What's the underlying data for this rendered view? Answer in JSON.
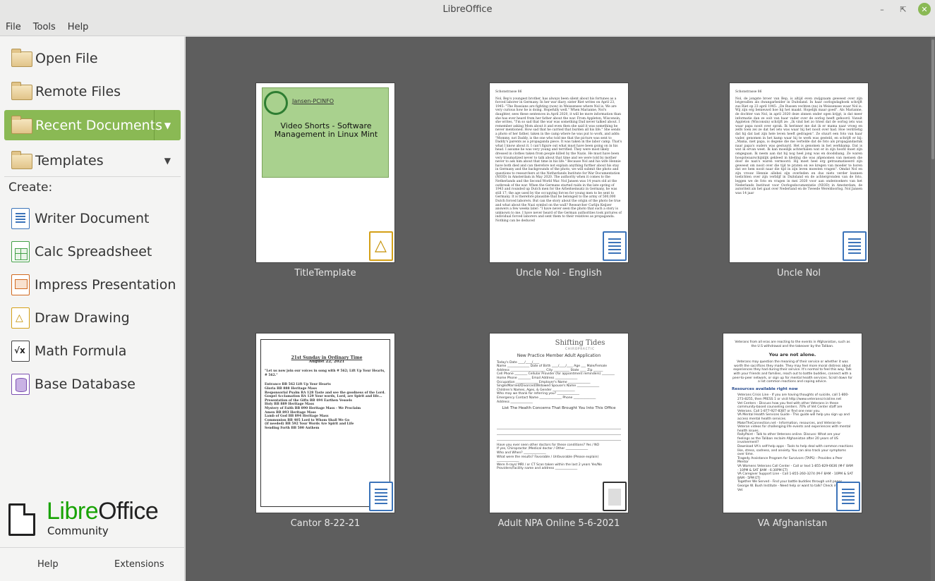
{
  "window": {
    "title": "LibreOffice"
  },
  "menu": [
    "File",
    "Tools",
    "Help"
  ],
  "sidebar": {
    "open_file": "Open File",
    "remote_files": "Remote Files",
    "recent_documents": "Recent Documents",
    "templates": "Templates",
    "create_label": "Create:",
    "create_items": [
      {
        "label": "Writer Document",
        "icon": "writer-icon"
      },
      {
        "label": "Calc Spreadsheet",
        "icon": "calc-icon"
      },
      {
        "label": "Impress Presentation",
        "icon": "impress-icon"
      },
      {
        "label": "Draw Drawing",
        "icon": "draw-icon"
      },
      {
        "label": "Math Formula",
        "icon": "math-icon"
      },
      {
        "label": "Base Database",
        "icon": "base-icon"
      }
    ],
    "logo": {
      "libre": "Libre",
      "office": "Office",
      "community": "Community"
    },
    "footer": {
      "help": "Help",
      "extensions": "Extensions"
    }
  },
  "accent_color": "#8ab954",
  "recent": [
    {
      "name": "TitleTemplate",
      "slide_brand": "Jansen-PCINFO",
      "slide_title": "Video Shorts - Software Management in Linux Mint"
    },
    {
      "name": "Uncle Nol - English",
      "heading": "Schonstrasse 86",
      "text": "Nol, Bep's youngest brother, has always been silent about his fortunes as a forced laborer in Germany. In her war diary, sister Riet writes on April 23, 1945: \"The Russians are fighting (now) in Weissensee where Nol is. We are very curious how he is doing. Hopefully well.\" When Marianne, Nol's daughter, sees these sentences in April 2020, it will be more information than she has ever heard from her father about the war. From Appleton, Wisconsin, she writes, \"I'm so sad that the war was something Dad never talked about. I remember asking Mom about it and even then she said it was something he never mentioned. How sad that he carried that burden all his life.\" She sends a photo of her father, taken in the camp where he was put to work, and adds: \"Mommy, not Daddy, is the one who told me that the picture was sent to Daddy's parents as a propaganda piece. It was taken in the labor camp. That's what I know about it. I can't figure out what must have been going on in his head. I assume he was very young and terrified. They were most likely dressed in clothes taken from people killed by the Nazis. He must have been very traumatized never to talk about that time and we were told by mother never to ask him about that time in his life.\" Because Nol and his wife Hennie have both died and can therefore not explain anything further about his stay in Germany and the backgrounds of the photo, we will submit the photo and questions to researchers at the Netherlands Institute for War Documentation (NIOD) in Amsterdam in May 2020. The authority when it comes to the Netherlands and the Second World War. Nol Jansen was 14 years old at the outbreak of the war. When the Germans started raids in the late spring of 1943 and rounded up Dutch men for the Arbeitseinsatz in Germany, he was still 17; the age used by the occupying forces for young men to be sent to Germany. It is therefore plausible that he belonged to the army of 500,000 Dutch forced laborers. But can the story about the origin of the photo be true and what about the Nazi symbol on the wall? Researcher Carlijn Keijzer answers a few weeks later: \"I have never seen the photo that such a story is unknown to me. I have never heard of the German authorities took pictures of individual forced laborers and sent them to their relatives as propaganda. Nothing can be deduced"
    },
    {
      "name": "Uncle Nol",
      "heading": "Schonstrasse 86",
      "text": "Nol, de jongste broer van Bep, is altijd even zwijgzaam geweest over zijn lotgevallen als dwangarbeider in Duitsland. In haar oorlogsdagboek schrijft zus Riet op 23 april 1945: „De Russen vechten (nu) in Weissensee waar Nol is. Wij zijn erg benieuwd hoe hij het maakt. Hopelijk maar goed\". Als Marianne, de dochter van Nol, in april 2020 deze zinnen onder ogen krijgt, is dat meer informatie dan ze ooit van haar vader over de oorlog heeft gehoord. Vanuit Appleton (Wisconsin) schrijft ze: „Ik vind het zo triest dat de oorlog iets was waar papa nooit over sprak. Ik herinner me dat ik er mama naar vroeg en zelfs toen zei ze dat het iets was waar hij het nooit over had. Hoe verdrietig dat hij dat last zijn hele leven heeft gedragen\". Ze stuurt een foto van haar vader, genomen in het kamp waar hij te werk was gesteld, en schrijft er bij: „Mama, niet papa, is degene die me vertelde dat de foto als propagandastuk naar papa's ouders was gestuurd. Het is genomen in het werkkamp. Dat is wat ik ervan weet. Ik kan moeilijk achterhalen wat er in zijn hoofd moet zijn omgegaan. Ik neem aan dat hij nog heel jong was en doodsbang. Ze waren hoogstwaarschijnlijk gekleed in kleding die was afgenomen van mensen die door de nazi's waren vermoord. Hij moet heel erg getraumatiseerd zijn geweest om nooit over die tijd te praten en we kregen van moeder te horen dat we hem nooit naar die tijd in zijn leven moesten vragen\". Omdat Nol en zijn vrouw Hennie allebei zijn overleden en dus niets verder kunnen toelichten over zijn verblijf in Duitsland en de achtergronden van de foto, leggen we de foto en vragen in mei 2020 voor aan onderzoekers van het Nederlands Instituut voor Oorlogsdocumentatie (NIOD) in Amsterdam, de autoriteit als het gaat over Nederland en de Tweede Wereldoorlog. Nol Jansen was 14 jaar"
    },
    {
      "name": "Cantor 8-22-21",
      "title": "21st Sunday in Ordinary Time",
      "date": "August 22, 2021",
      "intro": "\"Let us now join our voices in song with # 562; Lift Up Your Hearts, # 562.\"",
      "rows": [
        "Entrance        BB  562   Lift Up Your Hearts",
        "Gloria          BB  888   Heritage Mass",
        "Responsorial Psalm  RA 128  Taste and see the goodness of the Lord.",
        "Gospel Acclamation  RA 129  Your words, Lord, are Spirit and life...",
        "Presentation of the Gifts  BB 494  Earthen Vessels",
        "Holy            BB  889   Heritage Mass",
        "Mystery of Faith  BB  890  Heritage Mass - We Proclaim",
        "Amen            BB  893   Heritage Mass",
        "Lamb of God     BB  894   Heritage Mass",
        "Communion       BB  405   Lord to Whom Shall We Go",
        "(if needed)     BB  592   Your Words Are Spirit and Life",
        "Sending Forth   BB  500   Anthem"
      ]
    },
    {
      "name": "Adult NPA Online 5-6-2021",
      "brand": "Shifting Tides",
      "brand_sub": "CHIROPRACTIC",
      "form_title": "New Practice Member Adult Application",
      "section": "List The Health Concerns That Brought You Into This Office",
      "lines": [
        "Today's Date ____/____/____",
        "Name ______________ Date of Birth ____/____/____ Age ___ Male/Female",
        "Address ______________________ City __________ State ____ Zip ______",
        "Cell Phone ________ Cellular Provider (for appointment reminders) ________",
        "Home Phone ________ Email Address ______________",
        "Occupation ______________ Employer's Name ______________",
        "Single/Married/Divorced/Widowed Spouse's Name ______________",
        "Children's Names, Ages, & Gender ______________",
        "Who may we thank for referring you? ______________",
        "Emergency Contact Name ______________ Phone ______________",
        "Address ______________"
      ],
      "lines2": [
        "Have you ever seen other doctors for these conditions?   Yes / NO",
        "If yes,   Chiropractor /Medical doctor / Other ______________",
        "Who and When? ______________",
        "What were the results? Favorable / Unfavorable (Please explain) ______________",
        "Were X-rays/ MRI / or CT Scan taken within the last 2 years Yes/No",
        "Providers/Facility name and address ______________"
      ]
    },
    {
      "name": "VA Afghanistan",
      "p1": "Veterans from all eras are reacting to the events in Afghanistan, such as the U.S withdrawal and the takeover by the Taliban.",
      "heading": "You are not alone.",
      "p2": "Veterans may question the meaning of their service or whether it was worth the sacrifices they made. They may feel more moral distress about experiences they had during their service. It's normal to feel this way. Talk with your friends and families, reach out to battle buddies, connect with a peer-to-peer network, or sign up for mental health services. Scroll down for a list common reactions and coping advice.",
      "sub": "Resources available right now",
      "bullets": [
        "Veterans Crisis Line - If you are having thoughts of suicide, call 1-800-273-8255, then PRESS 1 or visit http://www.veteranscrisisline.net",
        "Vet Centers - Discuss how you feel with other Veterans in these community-based counseling centers. 70% of Vet Center staff are Veterans. Call 1-877-927-8387 or find one near you.",
        "VA Mental Health Services Guide - This guide will help you sign up and access mental health services.",
        "MakeTheConnection.net - Information, resources, and Veteran-to-Veteran videos for challenging life events and experiences with mental health issues.",
        "RallyPoint - Talk to other Veterans online. Discuss: What are your feelings as the Taliban reclaim Afghanistan after 20 years of US involvement?",
        "Download VA's self-help apps - Tools to help deal with common reactions like, stress, sadness, and anxiety. You can also track your symptoms over time.",
        "Tragedy Assistance Program for Survivors (TAPS) - Provides a Peer Mentor",
        "VA Womens Veterans Call Center - Call or text 1-855-829-6636 (M-F 8AM - 10PM & SAT 8AM - 6:30PM ET)",
        "VA Caregiver Support Line - Call 1-855-260-3274 (M-F 8AM - 10PM & SAT 8AM - 5PM ET)",
        "Together We Served - Find your battle buddies through unit pages.",
        "George W. Bush Institute - Need help or want to talk? Check in with a Vet"
      ]
    }
  ]
}
